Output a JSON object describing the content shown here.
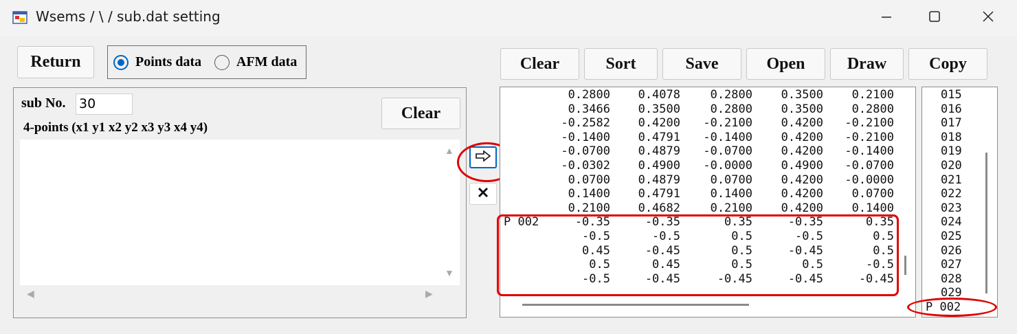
{
  "window": {
    "title": "Wsems / \\ / sub.dat setting",
    "icon": "app-window-icon"
  },
  "controls": {
    "minimize": "minimize-icon",
    "maximize": "maximize-icon",
    "close": "close-icon"
  },
  "left": {
    "return_label": "Return",
    "radio_points_label": "Points data",
    "radio_afm_label": "AFM data",
    "radio_selected": "points",
    "sub_no_label": "sub No.",
    "sub_no_value": "30",
    "clear_label": "Clear",
    "points_hint": "4-points (x1 y1 x2 y2 x3 y3 x4 y4)",
    "points_text": ""
  },
  "middle": {
    "transfer_icon": "right-arrow-icon",
    "delete_icon": "x-icon"
  },
  "toolbar": {
    "clear": "Clear",
    "sort": "Sort",
    "save": "Save",
    "open": "Open",
    "draw": "Draw",
    "copy": "Copy"
  },
  "data_rows": [
    {
      "tag": "",
      "v": [
        "0.2800",
        "0.4078",
        "0.2800",
        "0.3500",
        "0.2100"
      ]
    },
    {
      "tag": "",
      "v": [
        "0.3466",
        "0.3500",
        "0.2800",
        "0.3500",
        "0.2800"
      ]
    },
    {
      "tag": "",
      "v": [
        "-0.2582",
        "0.4200",
        "-0.2100",
        "0.4200",
        "-0.2100"
      ]
    },
    {
      "tag": "",
      "v": [
        "-0.1400",
        "0.4791",
        "-0.1400",
        "0.4200",
        "-0.2100"
      ]
    },
    {
      "tag": "",
      "v": [
        "-0.0700",
        "0.4879",
        "-0.0700",
        "0.4200",
        "-0.1400"
      ]
    },
    {
      "tag": "",
      "v": [
        "-0.0302",
        "0.4900",
        "-0.0000",
        "0.4900",
        "-0.0700"
      ]
    },
    {
      "tag": "",
      "v": [
        "0.0700",
        "0.4879",
        "0.0700",
        "0.4200",
        "-0.0000"
      ]
    },
    {
      "tag": "",
      "v": [
        "0.1400",
        "0.4791",
        "0.1400",
        "0.4200",
        "0.0700"
      ]
    },
    {
      "tag": "",
      "v": [
        "0.2100",
        "0.4682",
        "0.2100",
        "0.4200",
        "0.1400"
      ]
    },
    {
      "tag": "P 002",
      "v": [
        "-0.35",
        "-0.35",
        "0.35",
        "-0.35",
        "0.35"
      ]
    },
    {
      "tag": "",
      "v": [
        "-0.5",
        "-0.5",
        "0.5",
        "-0.5",
        "0.5"
      ]
    },
    {
      "tag": "",
      "v": [
        "0.45",
        "-0.45",
        "0.5",
        "-0.45",
        "0.5"
      ]
    },
    {
      "tag": "",
      "v": [
        "0.5",
        "0.45",
        "0.5",
        "0.5",
        "-0.5"
      ]
    },
    {
      "tag": "",
      "v": [
        "-0.5",
        "-0.45",
        "-0.45",
        "-0.45",
        "-0.45"
      ]
    }
  ],
  "index_list": [
    "015",
    "016",
    "017",
    "018",
    "019",
    "020",
    "021",
    "022",
    "023",
    "024",
    "025",
    "026",
    "027",
    "028",
    "029",
    "P 002"
  ],
  "colors": {
    "highlight": "#e00000",
    "radio": "#0067c0"
  }
}
